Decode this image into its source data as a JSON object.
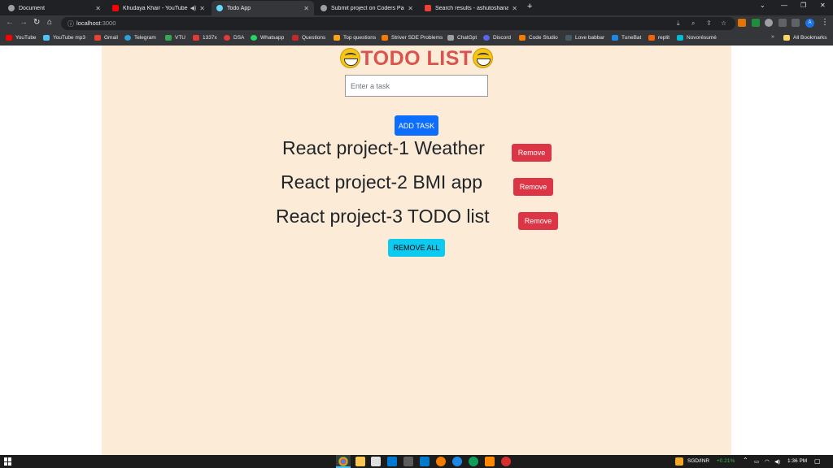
{
  "browser": {
    "tabs": [
      {
        "label": "Document",
        "active": false
      },
      {
        "label": "Khudaya Khair - YouTube",
        "active": false
      },
      {
        "label": "Todo App",
        "active": true
      },
      {
        "label": "Submit project on Coders Packe",
        "active": false
      },
      {
        "label": "Search results - ashutoshanand",
        "active": false
      }
    ],
    "url_host": "localhost",
    "url_port": ":3000",
    "bookmarks": [
      "YouTube",
      "YouTube mp3",
      "Gmail",
      "Telegram",
      "VTU",
      "1337x",
      "DSA",
      "Whatsapp",
      "Questions",
      "Top questions",
      "Striver SDE Problems",
      "ChatGpt",
      "Discord",
      "Code Studio",
      "Love babbar",
      "TuneBat",
      "replit",
      "Novorésumé"
    ],
    "all_bookmarks": "All Bookmarks",
    "profile_initial": "A"
  },
  "app": {
    "title": "TODO LIST",
    "input_placeholder": "Enter a task",
    "add_button": "ADD TASK",
    "todos": [
      {
        "text": "React project-1 Weather",
        "remove_label": "Remove"
      },
      {
        "text": "React project-2 BMI app",
        "remove_label": "Remove"
      },
      {
        "text": "React project-3 TODO list",
        "remove_label": "Remove"
      }
    ],
    "remove_all_button": "REMOVE ALL"
  },
  "taskbar": {
    "ticker": "SGD/INR",
    "ticker_change": "+0.21%",
    "time": "1:36 PM"
  },
  "colors": {
    "app_background": "#fcebd6",
    "title": "#d9534f",
    "add_button": "#0d6efd",
    "remove_button": "#dc3545",
    "remove_all_button": "#0dcaf0"
  }
}
